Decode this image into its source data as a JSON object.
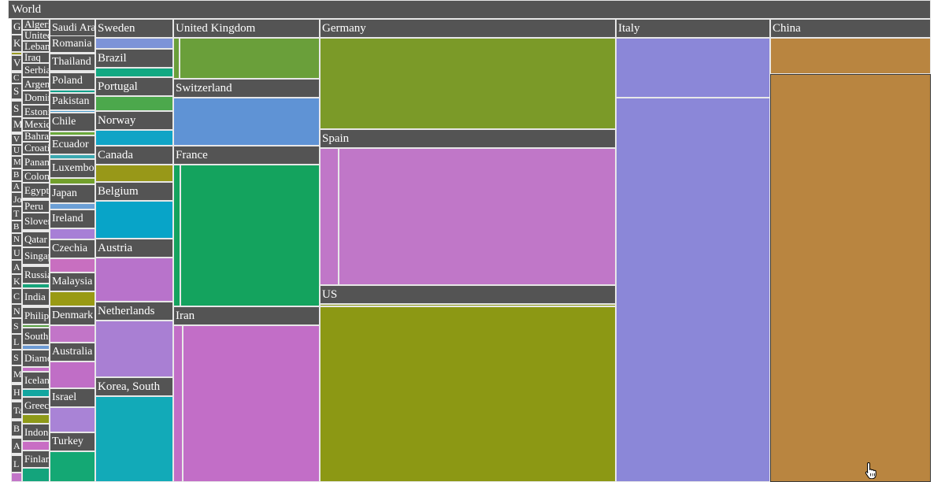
{
  "chart_data": {
    "type": "treemap",
    "root": "World",
    "countries": [
      {
        "name": "China",
        "color": "#b98540",
        "children": [
          {
            "color": "#b98540"
          },
          {
            "color": "#b98540"
          }
        ]
      },
      {
        "name": "Italy",
        "color": "#8b87d8",
        "children": [
          {
            "color": "#8b87d8"
          },
          {
            "color": "#8b87d8"
          }
        ]
      },
      {
        "name": "Germany",
        "color": "#7b9a28",
        "children": [
          {
            "color": "#7b9a28"
          }
        ]
      },
      {
        "name": "Spain",
        "color": "#c077c8",
        "children": [
          {
            "color": "#c077c8"
          },
          {
            "color": "#c077c8"
          }
        ]
      },
      {
        "name": "US",
        "color": "#8c9814",
        "children": [
          {
            "color": "#8c9814"
          },
          {
            "color": "#8c9814"
          }
        ]
      },
      {
        "name": "United Kingdom",
        "color": "#6a9f3a",
        "children": [
          {
            "color": "#6a9f3a"
          },
          {
            "color": "#6a9f3a"
          }
        ]
      },
      {
        "name": "Switzerland",
        "color": "#5f93d5",
        "children": [
          {
            "color": "#5f93d5"
          }
        ]
      },
      {
        "name": "France",
        "color": "#14a35e",
        "children": [
          {
            "color": "#14a35e"
          },
          {
            "color": "#14a35e"
          }
        ]
      },
      {
        "name": "Iran",
        "color": "#c26ec7",
        "children": [
          {
            "color": "#c26ec7"
          },
          {
            "color": "#c26ec7"
          }
        ]
      },
      {
        "name": "Sweden",
        "color": "#7d93d8",
        "children": [
          {
            "color": "#7d93d8"
          }
        ]
      },
      {
        "name": "Brazil",
        "color": "#12a882",
        "children": [
          {
            "color": "#12a882"
          }
        ]
      },
      {
        "name": "Portugal",
        "color": "#4ca84c",
        "children": [
          {
            "color": "#4ca84c"
          }
        ]
      },
      {
        "name": "Norway",
        "color": "#10a4c6",
        "children": [
          {
            "color": "#10a4c6"
          }
        ]
      },
      {
        "name": "Canada",
        "color": "#989818",
        "children": [
          {
            "color": "#989818"
          }
        ]
      },
      {
        "name": "Belgium",
        "color": "#08a4c8",
        "children": [
          {
            "color": "#08a4c8"
          }
        ]
      },
      {
        "name": "Austria",
        "color": "#b873cb",
        "children": [
          {
            "color": "#b873cb"
          }
        ]
      },
      {
        "name": "Netherlands",
        "color": "#a97fd3",
        "children": [
          {
            "color": "#a97fd3"
          }
        ]
      },
      {
        "name": "Korea, South",
        "color": "#12aab8",
        "children": [
          {
            "color": "#12aab8"
          }
        ]
      },
      {
        "name": "Saudi Arabia",
        "color": "#7b8ed6",
        "children": [
          {
            "color": "#7b8ed6"
          }
        ]
      },
      {
        "name": "Romania",
        "color": "#b45fc0",
        "children": [
          {
            "color": "#b45fc0"
          }
        ]
      },
      {
        "name": "Thailand",
        "color": "#5a9e3a",
        "children": [
          {
            "color": "#5a9e3a"
          }
        ]
      },
      {
        "name": "Poland",
        "color": "#0ea28c",
        "children": [
          {
            "color": "#0ea28c"
          }
        ]
      },
      {
        "name": "Pakistan",
        "color": "#4d9fd0",
        "children": [
          {
            "color": "#4d9fd0"
          }
        ]
      },
      {
        "name": "Chile",
        "color": "#6aa83a",
        "children": [
          {
            "color": "#6aa83a"
          }
        ]
      },
      {
        "name": "Ecuador",
        "color": "#3aa8b0",
        "children": [
          {
            "color": "#3aa8b0"
          }
        ]
      },
      {
        "name": "Luxembourg",
        "color": "#72a02c",
        "children": [
          {
            "color": "#72a02c"
          }
        ]
      },
      {
        "name": "Japan",
        "color": "#6b9fd6",
        "children": [
          {
            "color": "#6b9fd6"
          }
        ]
      },
      {
        "name": "Ireland",
        "color": "#a77fd6",
        "children": [
          {
            "color": "#a77fd6"
          }
        ]
      },
      {
        "name": "Czechia",
        "color": "#c86fc0",
        "children": [
          {
            "color": "#c86fc0"
          }
        ]
      },
      {
        "name": "Malaysia",
        "color": "#999a14",
        "children": [
          {
            "color": "#999a14"
          }
        ]
      },
      {
        "name": "Denmark",
        "color": "#c275c8",
        "children": [
          {
            "color": "#c275c8"
          }
        ]
      },
      {
        "name": "Australia",
        "color": "#c06ec6",
        "children": [
          {
            "color": "#c06ec6"
          }
        ]
      },
      {
        "name": "Israel",
        "color": "#a983d6",
        "children": [
          {
            "color": "#a983d6"
          }
        ]
      },
      {
        "name": "Turkey",
        "color": "#14a874",
        "children": [
          {
            "color": "#14a874"
          }
        ]
      },
      {
        "name": "Algeria",
        "color": "#16a884",
        "children": [
          {
            "color": "#16a884"
          }
        ]
      },
      {
        "name": "United Arab Emirates",
        "color": "#8f8fd8",
        "children": [
          {
            "color": "#8f8fd8"
          }
        ]
      },
      {
        "name": "Lebanon",
        "color": "#6ea03e",
        "children": [
          {
            "color": "#6ea03e"
          }
        ]
      },
      {
        "name": "Iraq",
        "color": "#7f9c30",
        "children": [
          {
            "color": "#7f9c30"
          }
        ]
      },
      {
        "name": "Serbia",
        "color": "#4ca0c8",
        "children": [
          {
            "color": "#4ca0c8"
          }
        ]
      },
      {
        "name": "Argentina",
        "color": "#b678c9",
        "children": [
          {
            "color": "#b678c9"
          }
        ]
      },
      {
        "name": "Dominican Republic",
        "color": "#9a9a22",
        "children": [
          {
            "color": "#9a9a22"
          }
        ]
      },
      {
        "name": "Estonia",
        "color": "#5fa0d2",
        "children": [
          {
            "color": "#5fa0d2"
          }
        ]
      },
      {
        "name": "Mexico",
        "color": "#12a870",
        "children": [
          {
            "color": "#12a870"
          }
        ]
      },
      {
        "name": "Bahrain",
        "color": "#c172c6",
        "children": [
          {
            "color": "#c172c6"
          }
        ]
      },
      {
        "name": "Croatia",
        "color": "#84a03a",
        "children": [
          {
            "color": "#84a03a"
          }
        ]
      },
      {
        "name": "Panama",
        "color": "#3ea4c2",
        "children": [
          {
            "color": "#3ea4c2"
          }
        ]
      },
      {
        "name": "Colombia",
        "color": "#a07fd2",
        "children": [
          {
            "color": "#a07fd2"
          }
        ]
      },
      {
        "name": "Egypt",
        "color": "#4aa84e",
        "children": [
          {
            "color": "#4aa84e"
          }
        ]
      },
      {
        "name": "Peru",
        "color": "#8f96d8",
        "children": [
          {
            "color": "#8f96d8"
          }
        ]
      },
      {
        "name": "Slovenia",
        "color": "#c979c2",
        "children": [
          {
            "color": "#c979c2"
          }
        ]
      },
      {
        "name": "Qatar",
        "color": "#2aa6b8",
        "children": [
          {
            "color": "#2aa6b8"
          }
        ]
      },
      {
        "name": "Singapore",
        "color": "#9c9c1e",
        "children": [
          {
            "color": "#9c9c1e"
          }
        ]
      },
      {
        "name": "Russia",
        "color": "#16a47a",
        "children": [
          {
            "color": "#16a47a"
          }
        ]
      },
      {
        "name": "India",
        "color": "#b77acc",
        "children": [
          {
            "color": "#b77acc"
          }
        ]
      },
      {
        "name": "Philippines",
        "color": "#5aa044",
        "children": [
          {
            "color": "#5aa044"
          }
        ]
      },
      {
        "name": "South Africa",
        "color": "#6c9ad4",
        "children": [
          {
            "color": "#6c9ad4"
          }
        ]
      },
      {
        "name": "Diamond Princess",
        "color": "#c46ec4",
        "children": [
          {
            "color": "#c46ec4"
          }
        ]
      },
      {
        "name": "Iceland",
        "color": "#12a6a0",
        "children": [
          {
            "color": "#12a6a0"
          }
        ]
      },
      {
        "name": "Greece",
        "color": "#8e9a18",
        "children": [
          {
            "color": "#8e9a18"
          }
        ]
      },
      {
        "name": "Indonesia",
        "color": "#c86ec4",
        "children": [
          {
            "color": "#c86ec4"
          }
        ]
      },
      {
        "name": "Finland",
        "color": "#14a47c",
        "children": [
          {
            "color": "#14a47c"
          }
        ]
      },
      {
        "name": "G",
        "color": "#5aa0d0",
        "children": [
          {
            "color": "#5aa0d0"
          }
        ]
      },
      {
        "name": "K",
        "color": "#9a9a22",
        "children": [
          {
            "color": "#9a9a22"
          }
        ]
      },
      {
        "name": "V",
        "color": "#b87acc",
        "children": [
          {
            "color": "#b87acc"
          }
        ]
      },
      {
        "name": "C",
        "color": "#16a47a",
        "children": [
          {
            "color": "#16a47a"
          }
        ]
      },
      {
        "name": "S",
        "color": "#6a9e3c",
        "children": [
          {
            "color": "#6a9e3c"
          }
        ]
      },
      {
        "name": "S",
        "color": "#3aa4c4",
        "children": [
          {
            "color": "#3aa4c4"
          }
        ]
      },
      {
        "name": "M",
        "color": "#c172c6",
        "children": [
          {
            "color": "#c172c6"
          }
        ]
      },
      {
        "name": "V",
        "color": "#8f8fd8",
        "children": [
          {
            "color": "#8f8fd8"
          }
        ]
      },
      {
        "name": "U",
        "color": "#12a884",
        "children": [
          {
            "color": "#12a884"
          }
        ]
      },
      {
        "name": "M",
        "color": "#9a9a22",
        "children": [
          {
            "color": "#9a9a22"
          }
        ]
      },
      {
        "name": "B",
        "color": "#5fa0d2",
        "children": [
          {
            "color": "#5fa0d2"
          }
        ]
      },
      {
        "name": "A",
        "color": "#c979c2",
        "children": [
          {
            "color": "#c979c2"
          }
        ]
      },
      {
        "name": "Jo",
        "color": "#4aa84e",
        "children": [
          {
            "color": "#4aa84e"
          }
        ]
      },
      {
        "name": "T",
        "color": "#2aa6b8",
        "children": [
          {
            "color": "#2aa6b8"
          }
        ]
      },
      {
        "name": "B",
        "color": "#a07fd2",
        "children": [
          {
            "color": "#a07fd2"
          }
        ]
      },
      {
        "name": "N",
        "color": "#84a03a",
        "children": [
          {
            "color": "#84a03a"
          }
        ]
      },
      {
        "name": "U",
        "color": "#6c9ad4",
        "children": [
          {
            "color": "#6c9ad4"
          }
        ]
      },
      {
        "name": "A",
        "color": "#c46ec4",
        "children": [
          {
            "color": "#c46ec4"
          }
        ]
      },
      {
        "name": "K",
        "color": "#16a47a",
        "children": [
          {
            "color": "#16a47a"
          }
        ]
      },
      {
        "name": "C",
        "color": "#8e9a18",
        "children": [
          {
            "color": "#8e9a18"
          }
        ]
      },
      {
        "name": "N",
        "color": "#5aa044",
        "children": [
          {
            "color": "#5aa044"
          }
        ]
      },
      {
        "name": "S",
        "color": "#b678c9",
        "children": [
          {
            "color": "#b678c9"
          }
        ]
      },
      {
        "name": "L",
        "color": "#12a6a0",
        "children": [
          {
            "color": "#12a6a0"
          }
        ]
      },
      {
        "name": "S",
        "color": "#7f9c30",
        "children": [
          {
            "color": "#7f9c30"
          }
        ]
      },
      {
        "name": "M",
        "color": "#c86ec4",
        "children": [
          {
            "color": "#c86ec4"
          }
        ]
      },
      {
        "name": "H",
        "color": "#4ca0c8",
        "children": [
          {
            "color": "#4ca0c8"
          }
        ]
      },
      {
        "name": "Ta",
        "color": "#14a874",
        "children": [
          {
            "color": "#14a874"
          }
        ]
      },
      {
        "name": "B",
        "color": "#a983d6",
        "children": [
          {
            "color": "#a983d6"
          }
        ]
      },
      {
        "name": "A",
        "color": "#999a14",
        "children": [
          {
            "color": "#999a14"
          }
        ]
      },
      {
        "name": "L",
        "color": "#c275c8",
        "children": [
          {
            "color": "#c275c8"
          }
        ]
      }
    ]
  }
}
